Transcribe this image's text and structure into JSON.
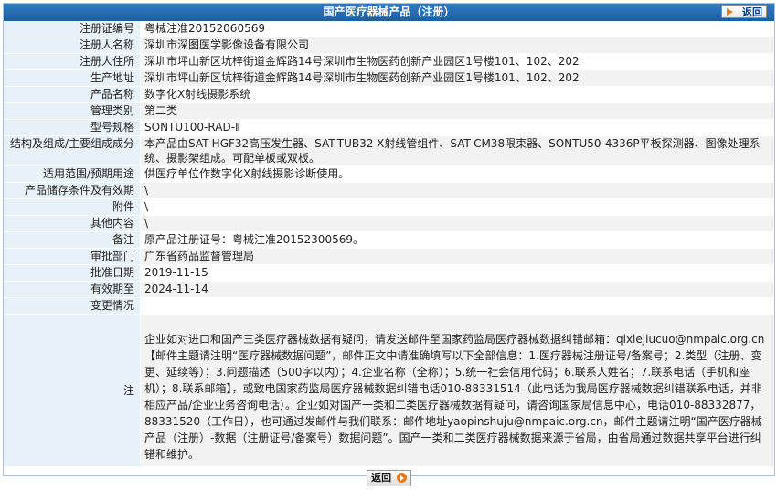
{
  "header": {
    "title": "国产医疗器械产品（注册）",
    "back_label": "返回"
  },
  "fields": [
    {
      "label": "注册证编号",
      "value": "粤械注准20152060569"
    },
    {
      "label": "注册人名称",
      "value": "深圳市深图医学影像设备有限公司"
    },
    {
      "label": "注册人住所",
      "value": "深圳市坪山新区坑梓街道金辉路14号深圳市生物医药创新产业园区1号楼101、102、202"
    },
    {
      "label": "生产地址",
      "value": "深圳市坪山新区坑梓街道金辉路14号深圳市生物医药创新产业园区1号楼101、102、202"
    },
    {
      "label": "产品名称",
      "value": "数字化X射线摄影系统"
    },
    {
      "label": "管理类别",
      "value": "第二类"
    },
    {
      "label": "型号规格",
      "value": "SONTU100-RAD-Ⅱ"
    },
    {
      "label": "结构及组成/主要组成成分",
      "value": "本产品由SAT-HGF32高压发生器、SAT-TUB32 X射线管组件、SAT-CM38限束器、SONTU50-4336P平板探测器、图像处理系统、摄影架组成。可配单板或双板。"
    },
    {
      "label": "适用范围/预期用途",
      "value": "供医疗单位作数字化X射线摄影诊断使用。"
    },
    {
      "label": "产品储存条件及有效期",
      "value": "\\"
    },
    {
      "label": "附件",
      "value": "\\"
    },
    {
      "label": "其他内容",
      "value": "\\"
    },
    {
      "label": "备注",
      "value": "原产品注册证号：粤械注准20152300569。"
    },
    {
      "label": "审批部门",
      "value": "广东省药品监督管理局"
    },
    {
      "label": "批准日期",
      "value": "2019-11-15"
    },
    {
      "label": "有效期至",
      "value": "2024-11-14"
    },
    {
      "label": "变更情况",
      "value": ""
    }
  ],
  "note": {
    "label": "注",
    "text": "企业如对进口和国产三类医疗器械数据有疑问，请发送邮件至国家药监局医疗器械数据纠错邮箱：qixiejiucuo@nmpaic.org.cn【邮件主题请注明“医疗器械数据问题”，邮件正文中请准确填写以下全部信息：1.医疗器械注册证号/备案号；2.类型（注册、变更、延续等）；3.问题描述（500字以内）；4.企业名称（全称）；5.统一社会信用代码；6.联系人姓名；7.联系电话（手机和座机）；8.联系邮箱】，或致电国家药监局医疗器械数据纠错电话010-88331514（此电话为我局医疗器械数据纠错联系电话，并非相应产品/企业业务咨询电话）。企业如对国产一类和二类医疗器械数据有疑问，请咨询国家局信息中心，电话010-88332877，88331520（工作日），也可通过发邮件与我们联系：邮件地址yaopinshuju@nmpaic.org.cn，邮件主题请注明“国产医疗器械产品（注册）-数据（注册证号/备案号）数据问题”。国产一类和二类医疗器械数据来源于省局，由省局通过数据共享平台进行纠错和维护。"
  },
  "footer": {
    "back_label": "返回"
  }
}
